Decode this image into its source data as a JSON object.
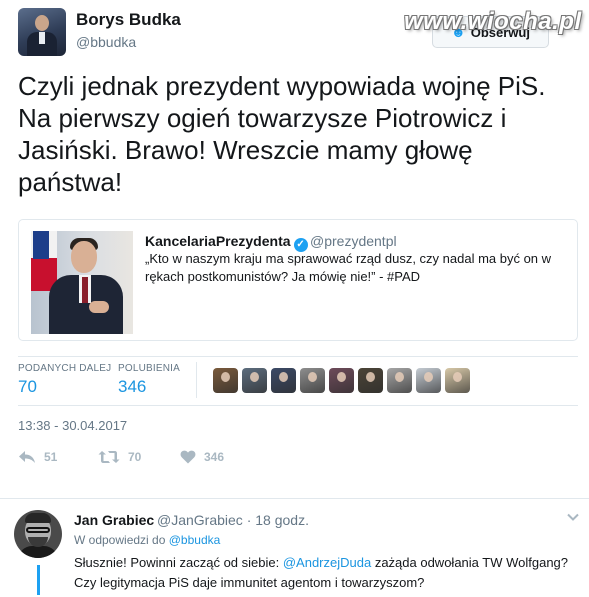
{
  "tweet": {
    "author_name": "Borys Budka",
    "author_handle": "@bbudka",
    "follow_label": "Obserwuj",
    "text": "Czyli jednak prezydent wypowiada wojnę PiS. Na pierwszy ogień towarzysze Piotrowicz i Jasiński. Brawo! Wreszcie mamy głowę państwa!",
    "watermark": "www.wiocha.pl",
    "quoted": {
      "name": "KancelariaPrezydenta",
      "handle": "@prezydentpl",
      "text": "„Kto w naszym kraju ma sprawować rząd dusz, czy nadal ma być on w rękach postkomunistów? Ja mówię nie!” - #PAD"
    },
    "stats": {
      "retweets_label": "PODANYCH DALEJ",
      "retweets_value": "70",
      "likes_label": "POLUBIENIA",
      "likes_value": "346"
    },
    "likers": [
      {
        "icon": "liker-avatar-1",
        "color": "#7a5a3c"
      },
      {
        "icon": "liker-avatar-2",
        "color": "#5d6d7e"
      },
      {
        "icon": "liker-avatar-3",
        "color": "#3c4a66"
      },
      {
        "icon": "liker-avatar-4",
        "color": "#8e8e8e"
      },
      {
        "icon": "liker-avatar-5",
        "color": "#6e4b5a"
      },
      {
        "icon": "liker-avatar-6",
        "color": "#4b4437"
      },
      {
        "icon": "liker-avatar-7",
        "color": "#a7a7a7"
      },
      {
        "icon": "liker-avatar-8",
        "color": "#c5ccd3"
      },
      {
        "icon": "liker-avatar-9",
        "color": "#d8c9a8"
      }
    ],
    "timestamp": "13:38 - 30.04.2017",
    "actions": {
      "reply_count": "51",
      "retweet_count": "70",
      "like_count": "346"
    }
  },
  "reply": {
    "author_name": "Jan Grabiec",
    "author_meta": "@JanGrabiec · 18 godz.",
    "in_reply_prefix": "W odpowiedzi do",
    "in_reply_mention": "@bbudka",
    "text_part1": "Słusznie! Powinni zacząć od siebie: ",
    "text_mention": "@AndrzejDuda",
    "text_part2": " zażąda odwołania TW Wolfgang? Czy legitymacja PiS daje immunitet agentom i towarzyszom?"
  },
  "colors": {
    "link_blue": "#1b95e0",
    "twitter_blue": "#1da1f2",
    "muted_gray": "#657786",
    "icon_gray": "#aab8c2",
    "border": "#e1e8ed"
  }
}
